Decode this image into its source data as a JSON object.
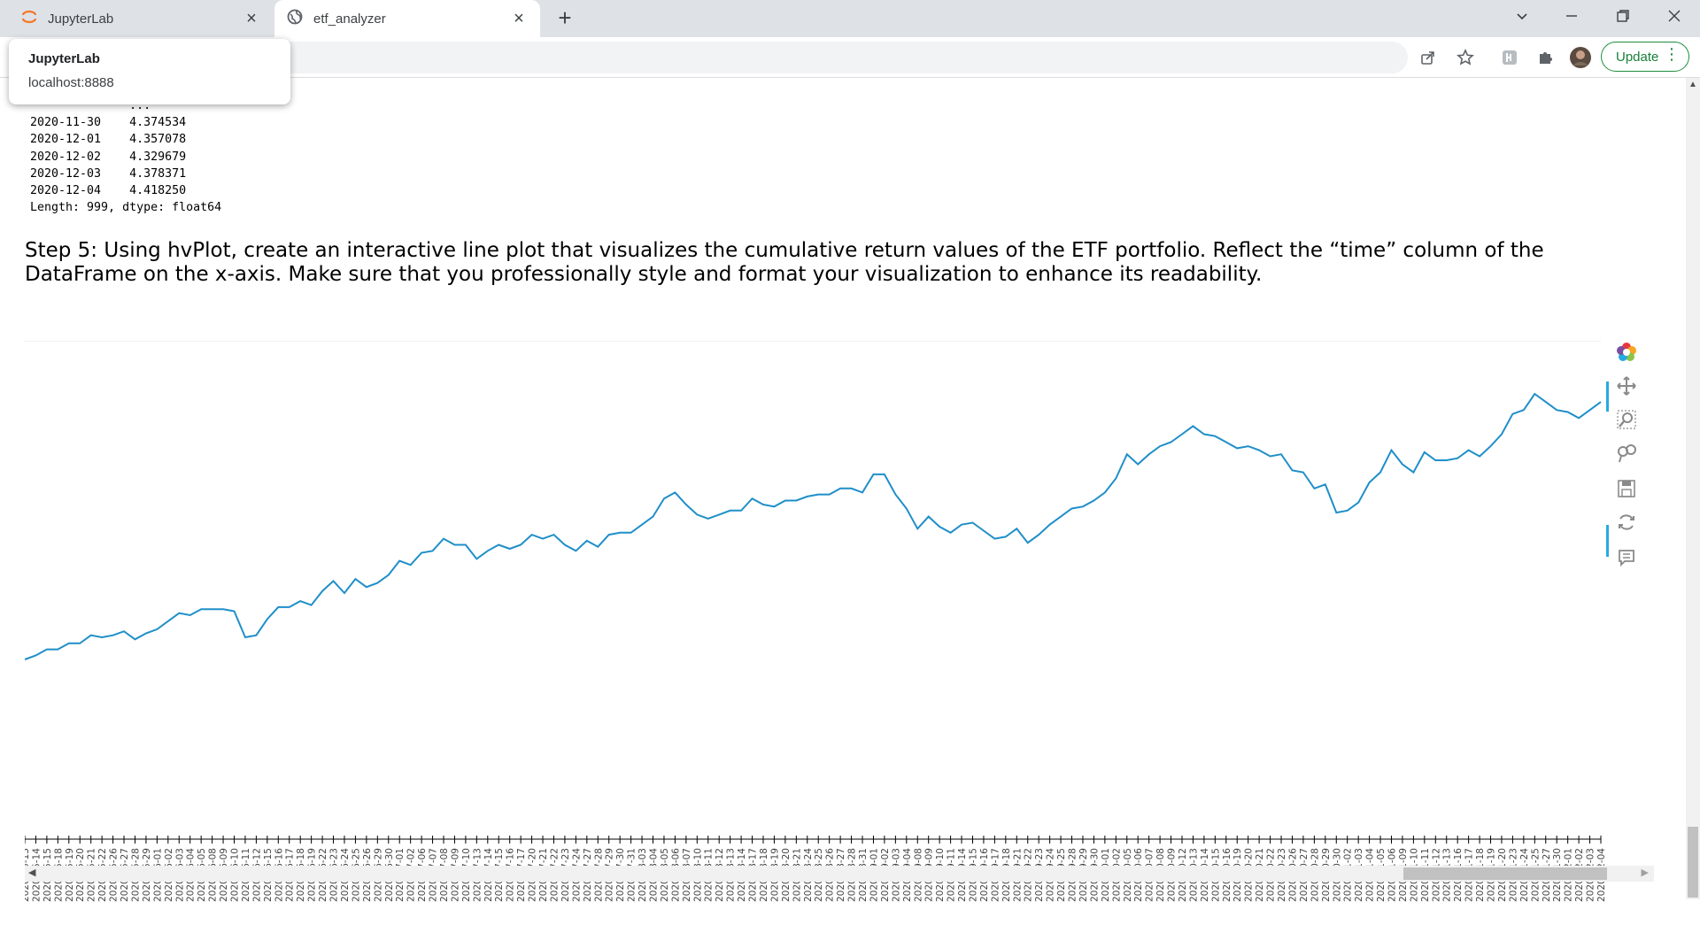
{
  "browser": {
    "tabs": [
      {
        "label": "JupyterLab"
      },
      {
        "label": "etf_analyzer"
      }
    ],
    "tooltip": {
      "title": "JupyterLab",
      "url": "localhost:8888"
    },
    "update_label": "Update"
  },
  "output": {
    "lines": [
      "              ...",
      "2020-11-30    4.374534",
      "2020-12-01    4.357078",
      "2020-12-02    4.329679",
      "2020-12-03    4.378371",
      "2020-12-04    4.418250",
      "Length: 999, dtype: float64"
    ]
  },
  "heading": "Step 5: Using hvPlot, create an interactive line plot that visualizes the cumulative return values of the ETF portfolio. Reflect the “time” column of the DataFrame on the x-axis. Make sure that you professionally style and format your visualization to enhance its readability.",
  "colors": {
    "line": "#1f8fc9",
    "accent": "#26aae1",
    "update_green": "#188038"
  },
  "toolbar_icons": [
    "bokeh-logo-icon",
    "pan-icon",
    "box-zoom-icon",
    "wheel-zoom-icon",
    "save-icon",
    "reset-icon",
    "hover-icon"
  ],
  "chart_data": {
    "type": "line",
    "title": "",
    "xlabel": "",
    "ylabel": "",
    "grid": false,
    "x": [
      "2020-05-13",
      "2020-05-14",
      "2020-05-15",
      "2020-05-18",
      "2020-05-19",
      "2020-05-20",
      "2020-05-21",
      "2020-05-22",
      "2020-05-26",
      "2020-05-27",
      "2020-05-28",
      "2020-05-29",
      "2020-06-01",
      "2020-06-02",
      "2020-06-03",
      "2020-06-04",
      "2020-06-05",
      "2020-06-08",
      "2020-06-09",
      "2020-06-10",
      "2020-06-11",
      "2020-06-12",
      "2020-06-15",
      "2020-06-16",
      "2020-06-17",
      "2020-06-18",
      "2020-06-19",
      "2020-06-22",
      "2020-06-23",
      "2020-06-24",
      "2020-06-25",
      "2020-06-26",
      "2020-06-29",
      "2020-06-30",
      "2020-07-01",
      "2020-07-02",
      "2020-07-06",
      "2020-07-07",
      "2020-07-08",
      "2020-07-09",
      "2020-07-10",
      "2020-07-13",
      "2020-07-14",
      "2020-07-15",
      "2020-07-16",
      "2020-07-17",
      "2020-07-20",
      "2020-07-21",
      "2020-07-22",
      "2020-07-23",
      "2020-07-24",
      "2020-07-27",
      "2020-07-28",
      "2020-07-29",
      "2020-07-30",
      "2020-07-31",
      "2020-08-03",
      "2020-08-04",
      "2020-08-05",
      "2020-08-06",
      "2020-08-07",
      "2020-08-10",
      "2020-08-11",
      "2020-08-12",
      "2020-08-13",
      "2020-08-14",
      "2020-08-17",
      "2020-08-18",
      "2020-08-19",
      "2020-08-20",
      "2020-08-21",
      "2020-08-24",
      "2020-08-25",
      "2020-08-26",
      "2020-08-27",
      "2020-08-28",
      "2020-08-31",
      "2020-09-01",
      "2020-09-02",
      "2020-09-03",
      "2020-09-04",
      "2020-09-08",
      "2020-09-09",
      "2020-09-10",
      "2020-09-11",
      "2020-09-14",
      "2020-09-15",
      "2020-09-16",
      "2020-09-17",
      "2020-09-18",
      "2020-09-21",
      "2020-09-22",
      "2020-09-23",
      "2020-09-24",
      "2020-09-25",
      "2020-09-28",
      "2020-09-29",
      "2020-09-30",
      "2020-10-01",
      "2020-10-02",
      "2020-10-05",
      "2020-10-06",
      "2020-10-07",
      "2020-10-08",
      "2020-10-09",
      "2020-10-12",
      "2020-10-13",
      "2020-10-14",
      "2020-10-15",
      "2020-10-16",
      "2020-10-19",
      "2020-10-20",
      "2020-10-21",
      "2020-10-22",
      "2020-10-23",
      "2020-10-26",
      "2020-10-27",
      "2020-10-28",
      "2020-10-29",
      "2020-10-30",
      "2020-11-02",
      "2020-11-03",
      "2020-11-04",
      "2020-11-05",
      "2020-11-06",
      "2020-11-09",
      "2020-11-10",
      "2020-11-11",
      "2020-11-12",
      "2020-11-13",
      "2020-11-16",
      "2020-11-17",
      "2020-11-18",
      "2020-11-19",
      "2020-11-20",
      "2020-11-23",
      "2020-11-24",
      "2020-11-25",
      "2020-11-27",
      "2020-11-30",
      "2020-12-01",
      "2020-12-02",
      "2020-12-03",
      "2020-12-04"
    ],
    "values": [
      0.6,
      0.62,
      0.65,
      0.65,
      0.68,
      0.68,
      0.72,
      0.71,
      0.72,
      0.74,
      0.7,
      0.73,
      0.75,
      0.79,
      0.83,
      0.82,
      0.85,
      0.85,
      0.85,
      0.84,
      0.71,
      0.72,
      0.8,
      0.86,
      0.86,
      0.89,
      0.87,
      0.94,
      0.99,
      0.93,
      1.0,
      0.96,
      0.98,
      1.02,
      1.09,
      1.07,
      1.13,
      1.14,
      1.2,
      1.17,
      1.17,
      1.1,
      1.14,
      1.17,
      1.15,
      1.17,
      1.22,
      1.2,
      1.22,
      1.17,
      1.14,
      1.19,
      1.16,
      1.22,
      1.23,
      1.23,
      1.27,
      1.31,
      1.4,
      1.43,
      1.37,
      1.32,
      1.3,
      1.32,
      1.34,
      1.34,
      1.4,
      1.37,
      1.36,
      1.39,
      1.39,
      1.41,
      1.42,
      1.42,
      1.45,
      1.45,
      1.43,
      1.52,
      1.52,
      1.42,
      1.35,
      1.25,
      1.31,
      1.26,
      1.23,
      1.27,
      1.28,
      1.24,
      1.2,
      1.21,
      1.25,
      1.18,
      1.22,
      1.27,
      1.31,
      1.35,
      1.36,
      1.39,
      1.43,
      1.5,
      1.62,
      1.57,
      1.62,
      1.66,
      1.68,
      1.72,
      1.76,
      1.72,
      1.71,
      1.68,
      1.65,
      1.66,
      1.64,
      1.61,
      1.62,
      1.54,
      1.53,
      1.45,
      1.47,
      1.33,
      1.34,
      1.38,
      1.48,
      1.53,
      1.64,
      1.57,
      1.53,
      1.63,
      1.59,
      1.59,
      1.6,
      1.64,
      1.61,
      1.66,
      1.72,
      1.82,
      1.84,
      1.92,
      1.88,
      1.84,
      1.83,
      1.8,
      1.84,
      1.88
    ]
  }
}
